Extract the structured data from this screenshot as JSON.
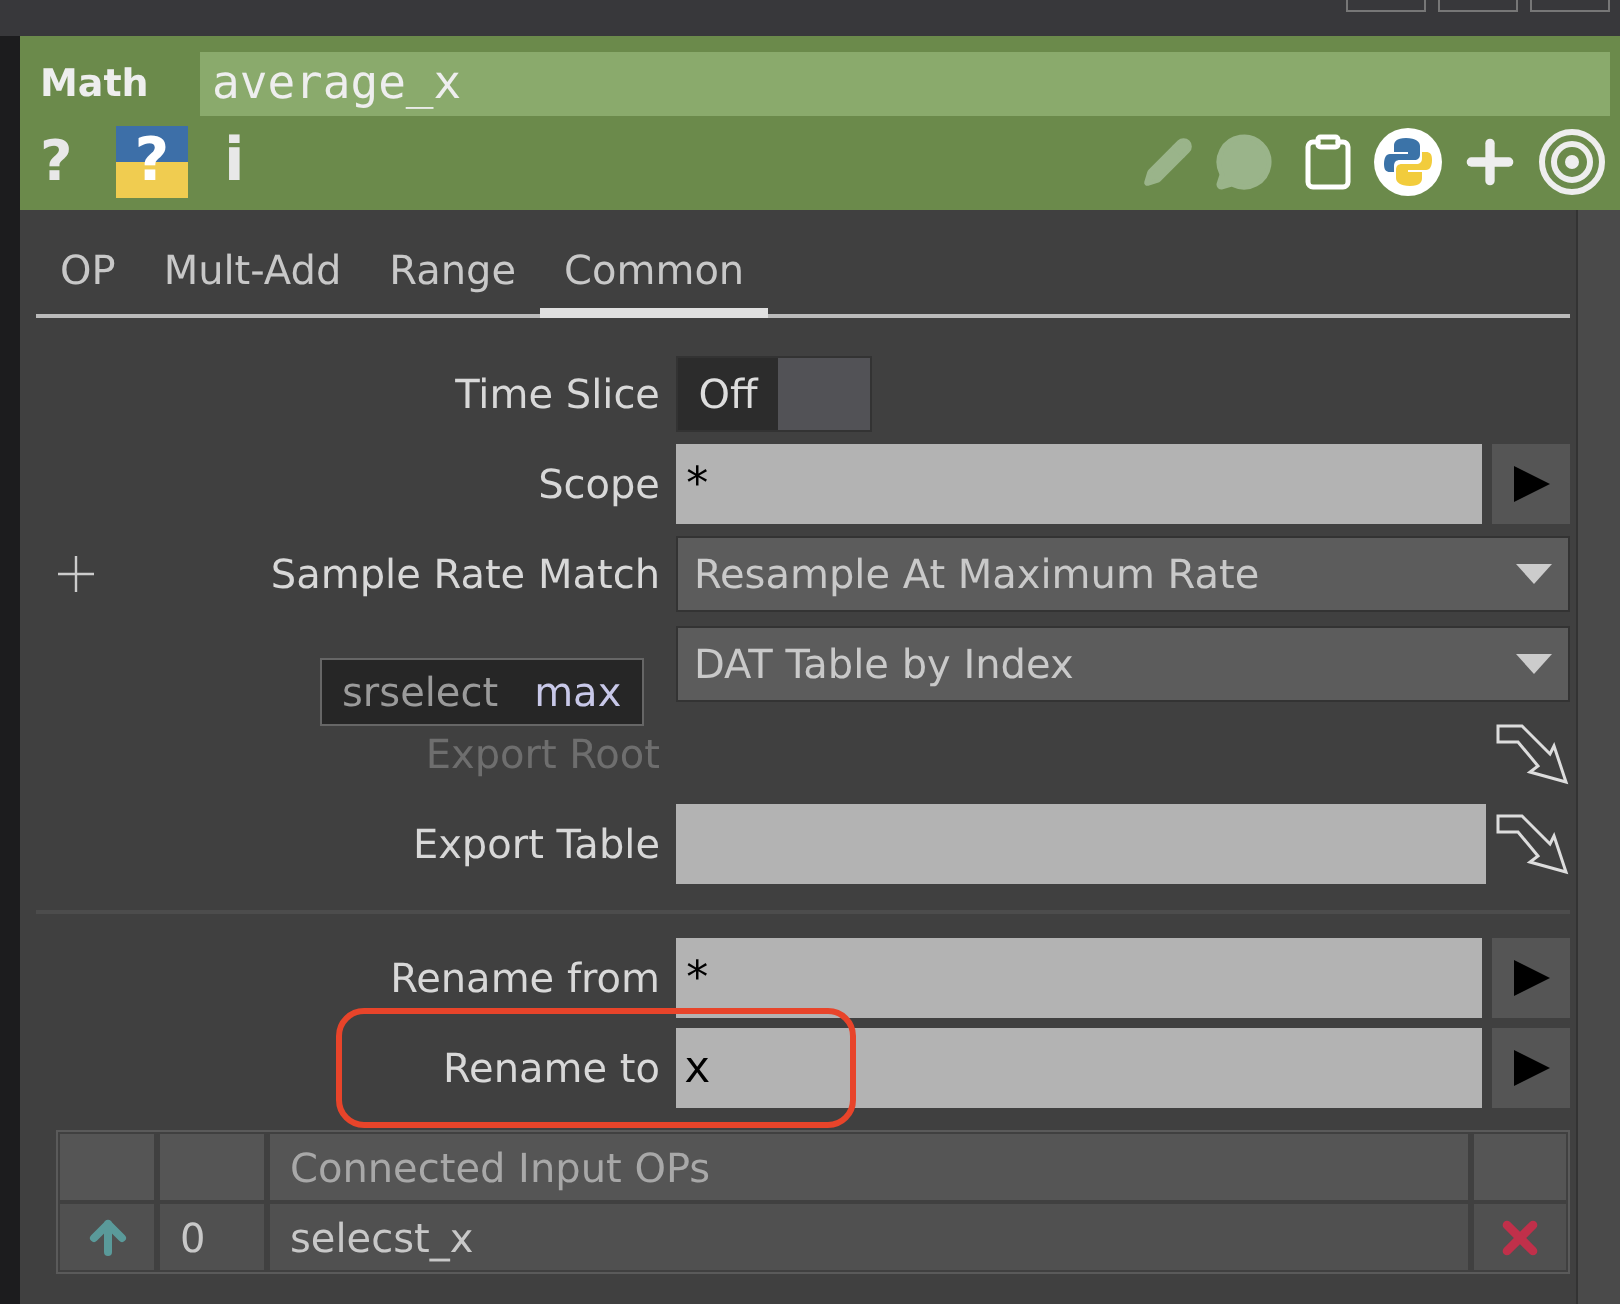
{
  "header": {
    "type_label": "Math",
    "name": "average_x",
    "glyphs": [
      "?",
      "?",
      "i"
    ]
  },
  "tabs": [
    {
      "label": "OP",
      "selected": false
    },
    {
      "label": "Mult-Add",
      "selected": false
    },
    {
      "label": "Range",
      "selected": false
    },
    {
      "label": "Common",
      "selected": true
    }
  ],
  "params": [
    {
      "kind": "toggle",
      "label": "Time Slice",
      "value": "Off",
      "on": false
    },
    {
      "kind": "string",
      "label": "Scope",
      "value": "*"
    },
    {
      "kind": "menu",
      "label": "Sample Rate Match",
      "value": "Resample At Maximum Rate",
      "expandable": true
    },
    {
      "kind": "menu",
      "value": "DAT Table by Index",
      "tooltip": {
        "name": "srselect",
        "value": "max"
      }
    },
    {
      "kind": "path",
      "label": "Export Root",
      "disabled": true
    },
    {
      "kind": "path",
      "label": "Export Table",
      "disabled": false
    }
  ],
  "rename_params": [
    {
      "kind": "string",
      "label": "Rename from",
      "value": "*",
      "highlighted": false
    },
    {
      "kind": "string",
      "label": "Rename to",
      "value": "x",
      "highlighted": true
    }
  ],
  "table": {
    "columns": [
      "Connected Input OPs"
    ],
    "rows": [
      {
        "index": "0",
        "name": "selecst_x"
      }
    ]
  }
}
